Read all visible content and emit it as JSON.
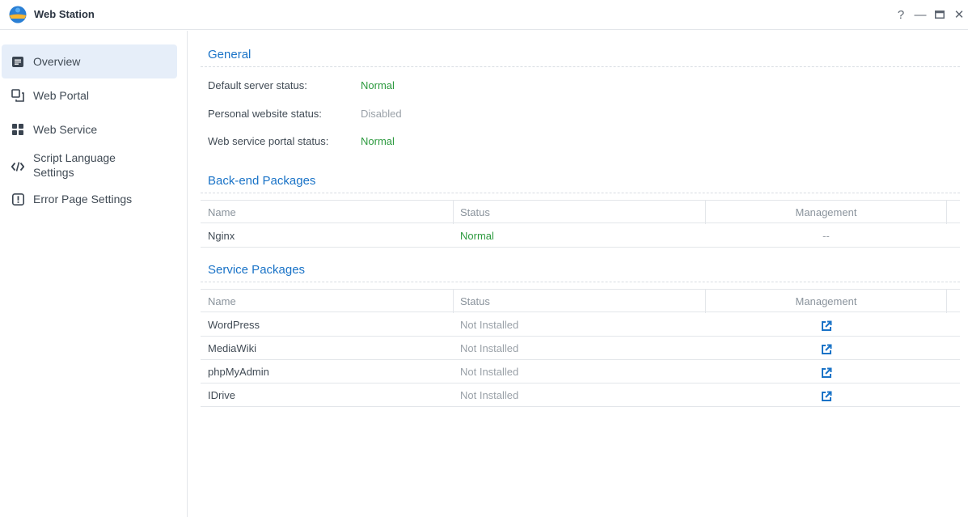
{
  "window": {
    "title": "Web Station",
    "controls": [
      "?",
      "—",
      "▭",
      "✕"
    ]
  },
  "sidebar": {
    "items": [
      {
        "label": "Overview",
        "icon": "overview-icon",
        "active": true
      },
      {
        "label": "Web Portal",
        "icon": "portal-icon"
      },
      {
        "label": "Web Service",
        "icon": "service-grid-icon"
      },
      {
        "label": "Script Language Settings",
        "label_line1": "Script Language",
        "label_line2": "Settings",
        "icon": "code-icon"
      },
      {
        "label": "Error Page Settings",
        "icon": "error-page-icon"
      }
    ]
  },
  "general": {
    "title": "General",
    "rows": [
      {
        "label": "Default server status:",
        "value": "Normal"
      },
      {
        "label": "Personal website status:",
        "value": "Disabled"
      },
      {
        "label": "Web service portal status:",
        "value": "Normal"
      }
    ]
  },
  "backend": {
    "title": "Back-end Packages",
    "headers": {
      "name": "Name",
      "status": "Status",
      "management": "Management"
    },
    "rows": [
      {
        "name": "Nginx",
        "status": "Normal",
        "management": "--"
      }
    ]
  },
  "service": {
    "title": "Service Packages",
    "headers": {
      "name": "Name",
      "status": "Status",
      "management": "Management"
    },
    "rows": [
      {
        "name": "WordPress",
        "status": "Not Installed",
        "management_icon": "external-link-icon"
      },
      {
        "name": "MediaWiki",
        "status": "Not Installed",
        "management_icon": "external-link-icon"
      },
      {
        "name": "phpMyAdmin",
        "status": "Not Installed",
        "management_icon": "external-link-icon"
      },
      {
        "name": "IDrive",
        "status": "Not Installed",
        "management_icon": "external-link-icon"
      }
    ]
  },
  "colors": {
    "accent": "#1a73c7",
    "normal": "#2d9a3f",
    "muted": "#9aa1a8",
    "active_bg": "#e6eef9"
  }
}
